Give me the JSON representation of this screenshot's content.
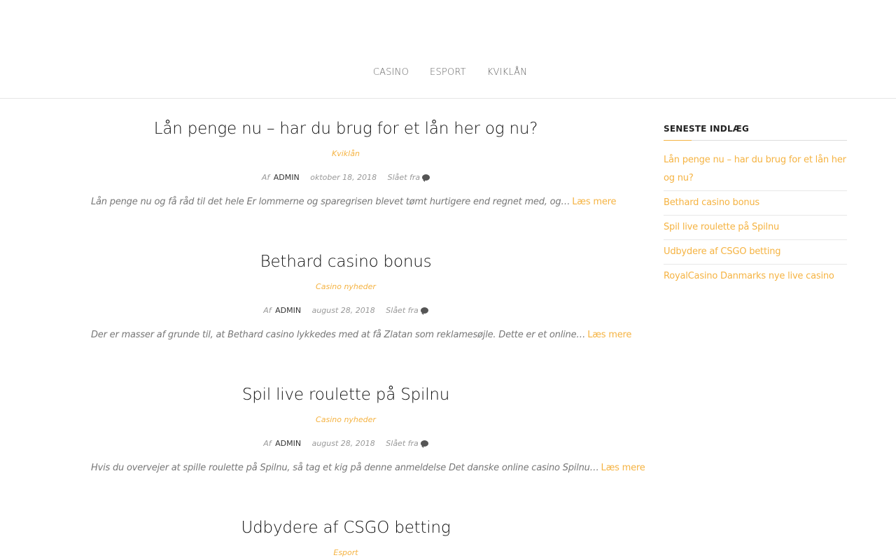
{
  "nav": {
    "items": [
      "CASINO",
      "ESPORT",
      "KVIKLÅN"
    ]
  },
  "posts": [
    {
      "title": "Lån penge nu – har du brug for et lån her og nu?",
      "category": "Kviklån",
      "by": "Af",
      "author": "ADMIN",
      "date": "oktober 18, 2018",
      "comments": "Slået fra",
      "excerpt": "Lån penge nu og få råd til det hele Er lommerne og sparegrisen blevet tømt hurtigere end regnet med, og…",
      "read_more": "Læs mere"
    },
    {
      "title": "Bethard casino bonus",
      "category": "Casino nyheder",
      "by": "Af",
      "author": "ADMIN",
      "date": "august 28, 2018",
      "comments": "Slået fra",
      "excerpt": "Der er masser af grunde til, at Bethard casino lykkedes med at få Zlatan som reklamesøjle. Dette er et online…",
      "read_more": "Læs mere"
    },
    {
      "title": "Spil live roulette på Spilnu",
      "category": "Casino nyheder",
      "by": "Af",
      "author": "ADMIN",
      "date": "august 28, 2018",
      "comments": "Slået fra",
      "excerpt": "Hvis du overvejer at spille roulette på Spilnu, så tag et kig på denne anmeldelse Det danske online casino Spilnu…",
      "read_more": "Læs mere"
    },
    {
      "title": "Udbydere af CSGO betting",
      "category": "Esport"
    }
  ],
  "sidebar": {
    "title": "SENESTE INDLÆG",
    "items": [
      "Lån penge nu – har du brug for et lån her og nu?",
      "Bethard casino bonus",
      "Spil live roulette på Spilnu",
      "Udbydere af CSGO betting",
      "RoyalCasino Danmarks nye live casino"
    ]
  },
  "colors": {
    "accent": "#f5b342",
    "text": "#111111",
    "muted": "#777777"
  },
  "icons": {
    "comments": "comment-icon"
  }
}
